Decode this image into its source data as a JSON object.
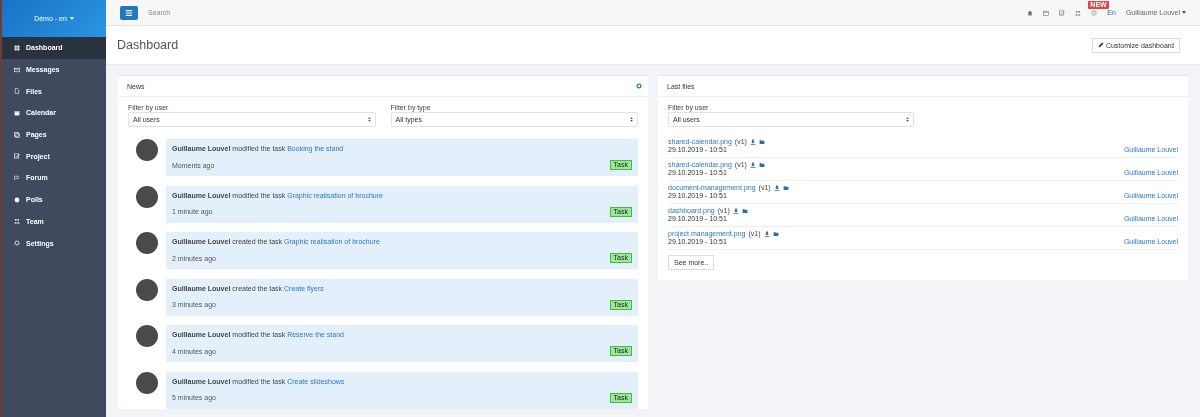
{
  "sidebar": {
    "brand": "Démo - en",
    "items": [
      {
        "label": "Dashboard",
        "selected": true
      },
      {
        "label": "Messages",
        "selected": false
      },
      {
        "label": "Files",
        "selected": false
      },
      {
        "label": "Calendar",
        "selected": false
      },
      {
        "label": "Pages",
        "selected": false
      },
      {
        "label": "Project",
        "selected": false
      },
      {
        "label": "Forum",
        "selected": false
      },
      {
        "label": "Polls",
        "selected": false
      },
      {
        "label": "Team",
        "selected": false
      },
      {
        "label": "Settings",
        "selected": false
      }
    ]
  },
  "topbar": {
    "search": {
      "placeholder": "Search"
    },
    "badge": "NEW",
    "language": "En",
    "user": "Guillaume Louvel"
  },
  "page": {
    "title": "Dashboard",
    "customize_button": "Customize dashboard"
  },
  "news": {
    "title": "News",
    "filters": [
      {
        "label": "Filter by user",
        "value": "All users"
      },
      {
        "label": "Filter by type",
        "value": "All types"
      }
    ],
    "items": [
      {
        "text": "**Guillaume Louvel** modified the task ",
        "link": "Booking the stand",
        "time": "Moments ago",
        "tag": "Task"
      },
      {
        "text": "**Guillaume Louvel** modified the task ",
        "link": "Graphic realisation of brochure",
        "time": "1 minute ago",
        "tag": "Task"
      },
      {
        "text": "**Guillaume Louvel** created the task ",
        "link": "Graphic realisation of brochure",
        "time": "2 minutes ago",
        "tag": "Task"
      },
      {
        "text": "**Guillaume Louvel** created the task ",
        "link": "Create flyers",
        "time": "3 minutes ago",
        "tag": "Task"
      },
      {
        "text": "**Guillaume Louvel** modified the task ",
        "link": "Reserve the stand",
        "time": "4 minutes ago",
        "tag": "Task"
      },
      {
        "text": "**Guillaume Louvel** modified the task ",
        "link": "Create slideshows",
        "time": "5 minutes ago",
        "tag": "Task"
      }
    ]
  },
  "files": {
    "title": "Last files",
    "filter": {
      "label": "Filter by user",
      "value": "All users"
    },
    "items": [
      {
        "name": "shared-calendar.png",
        "version": "(v1)",
        "date": "29.10.2019 - 10:51",
        "author": "Guillaume Louvel"
      },
      {
        "name": "shared-calendar.png",
        "version": "(v1)",
        "date": "29.10.2019 - 10:51",
        "author": "Guillaume Louvel"
      },
      {
        "name": "document-management.png",
        "version": "(v1)",
        "date": "29.10.2019 - 10:51",
        "author": "Guillaume Louvel"
      },
      {
        "name": "dashboard.png",
        "version": "(v1)",
        "date": "29.10.2019 - 10:51",
        "author": "Guillaume Louvel"
      },
      {
        "name": "project management.png",
        "version": "(v1)",
        "date": "29.10.2019 - 10:51",
        "author": "Guillaume Louvel"
      }
    ],
    "more_button": "See more.."
  }
}
